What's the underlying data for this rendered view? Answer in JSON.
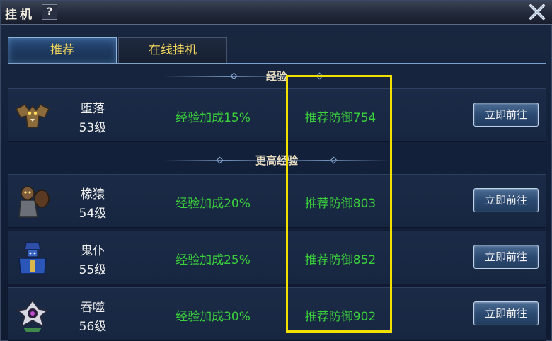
{
  "window": {
    "title": "挂机",
    "help_label": "?"
  },
  "tabs": [
    {
      "label": "推荐",
      "active": true
    },
    {
      "label": "在线挂机",
      "active": false
    }
  ],
  "sections": [
    {
      "title": "经验"
    },
    {
      "title": "更高经验"
    }
  ],
  "rows": [
    {
      "name": "堕落",
      "level": "53级",
      "exp_bonus": "经验加成15%",
      "defense": "推荐防御754",
      "button": "立即前往",
      "icon": "bat-demon-icon"
    },
    {
      "name": "橡猿",
      "level": "54级",
      "exp_bonus": "经验加成20%",
      "defense": "推荐防御803",
      "button": "立即前往",
      "icon": "ape-monster-icon"
    },
    {
      "name": "鬼仆",
      "level": "55级",
      "exp_bonus": "经验加成25%",
      "defense": "推荐防御852",
      "button": "立即前往",
      "icon": "ghost-servant-icon"
    },
    {
      "name": "吞噬",
      "level": "56级",
      "exp_bonus": "经验加成30%",
      "defense": "推荐防御902",
      "button": "立即前往",
      "icon": "devourer-icon"
    }
  ],
  "colors": {
    "bonus_text": "#3bd13b",
    "tab_text": "#f1d65a",
    "highlight": "#f2e000"
  }
}
